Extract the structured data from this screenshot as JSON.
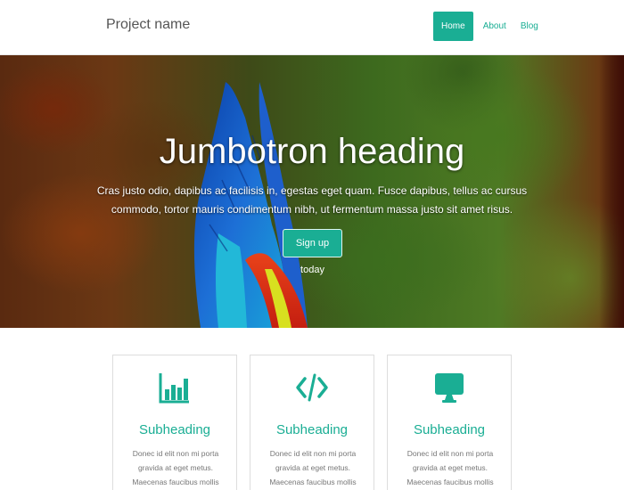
{
  "navbar": {
    "brand": "Project name",
    "links": [
      {
        "label": "Home",
        "active": true
      },
      {
        "label": "About",
        "active": false
      },
      {
        "label": "Blog",
        "active": false
      }
    ]
  },
  "jumbotron": {
    "heading": "Jumbotron heading",
    "text": "Cras justo odio, dapibus ac facilisis in, egestas eget quam. Fusce dapibus, tellus ac cursus commodo, tortor mauris condimentum nibh, ut fermentum massa justo sit amet risus.",
    "button_label": "Sign up today"
  },
  "features": [
    {
      "icon": "bar-chart-icon",
      "subheading": "Subheading",
      "text": "Donec id elit non mi porta gravida at eget metus. Maecenas faucibus mollis interdum."
    },
    {
      "icon": "code-icon",
      "subheading": "Subheading",
      "text": "Donec id elit non mi porta gravida at eget metus. Maecenas faucibus mollis interdum."
    },
    {
      "icon": "monitor-icon",
      "subheading": "Subheading",
      "text": "Donec id elit non mi porta gravida at eget metus. Maecenas faucibus mollis interdum."
    }
  ],
  "colors": {
    "accent": "#1aae94",
    "text_muted": "#777777",
    "brand_text": "#555555"
  }
}
